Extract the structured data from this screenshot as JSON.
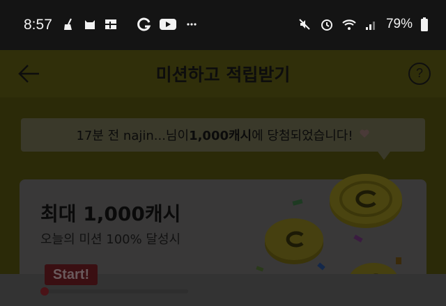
{
  "status_bar": {
    "time": "8:57",
    "battery_percent": "79%",
    "icons_left": [
      "broom-icon",
      "cat-icon",
      "grid-icon"
    ],
    "icons_mid": [
      "g-icon",
      "youtube-icon",
      "more-icon"
    ],
    "icons_right": [
      "mute-icon",
      "alarm-icon",
      "wifi-icon",
      "signal-icon",
      "battery-icon"
    ]
  },
  "header": {
    "title": "미션하고 적립받기",
    "help_label": "?"
  },
  "ticker": {
    "prefix": "17분 전 najin...님이 ",
    "amount": "1,000캐시",
    "suffix": "에 당첨되었습니다!"
  },
  "mission_card": {
    "title": "최대 1,000캐시",
    "subtitle": "오늘의 미션 100% 달성시",
    "start_label": "Start!",
    "progress": 0.0
  },
  "colors": {
    "brand_yellow": "#2b2a08",
    "accent_red": "#4a1317"
  }
}
